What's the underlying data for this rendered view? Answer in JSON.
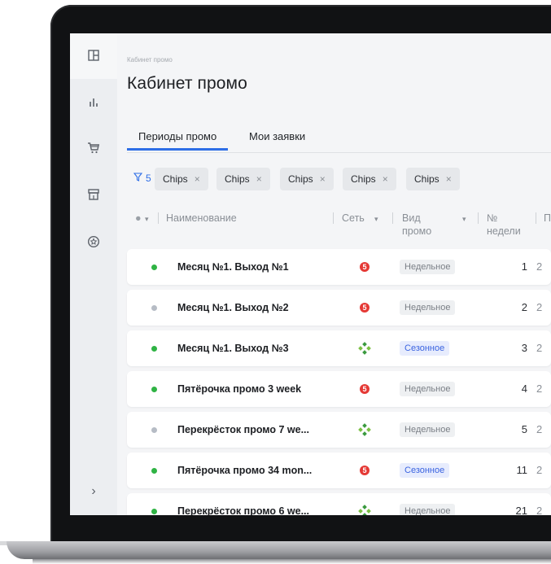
{
  "breadcrumb": "Кабинет промо",
  "page_title": "Кабинет промо",
  "tabs": [
    {
      "label": "Периоды промо",
      "active": true
    },
    {
      "label": "Мои заявки",
      "active": false
    }
  ],
  "filters": {
    "count": "5",
    "chips": [
      "Chips",
      "Chips",
      "Chips",
      "Chips",
      "Chips"
    ],
    "chip_close": "×"
  },
  "columns": {
    "status": "●",
    "name": "Наименование",
    "network": "Сеть",
    "type_line1": "Вид",
    "type_line2": "промо",
    "week_line1": "№",
    "week_line2": "недели",
    "next": "П"
  },
  "rows": [
    {
      "status": "active",
      "name": "Месяц №1. Выход №1",
      "network": "pyaterochka",
      "type": "Недельное",
      "type_kind": "weekly",
      "week": "1",
      "next": "2"
    },
    {
      "status": "inactive",
      "name": "Месяц №1. Выход №2",
      "network": "pyaterochka",
      "type": "Недельное",
      "type_kind": "weekly",
      "week": "2",
      "next": "2"
    },
    {
      "status": "active",
      "name": "Месяц №1. Выход №3",
      "network": "perekrestok",
      "type": "Сезонное",
      "type_kind": "season",
      "week": "3",
      "next": "2"
    },
    {
      "status": "active",
      "name": "Пятёрочка промо 3 week",
      "network": "pyaterochka",
      "type": "Недельное",
      "type_kind": "weekly",
      "week": "4",
      "next": "2"
    },
    {
      "status": "inactive",
      "name": "Перекрёсток промо 7 we...",
      "network": "perekrestok",
      "type": "Недельное",
      "type_kind": "weekly",
      "week": "5",
      "next": "2"
    },
    {
      "status": "active",
      "name": "Пятёрочка промо 34 mon...",
      "network": "pyaterochka",
      "type": "Сезонное",
      "type_kind": "season",
      "week": "11",
      "next": "2"
    },
    {
      "status": "active",
      "name": "Перекрёсток промо 6 we...",
      "network": "perekrestok",
      "type": "Недельное",
      "type_kind": "weekly",
      "week": "21",
      "next": "2"
    }
  ],
  "sidebar": {
    "items": [
      "layout-icon",
      "bar-chart-icon",
      "cart-icon",
      "store-icon",
      "badge-icon"
    ],
    "expand": "›"
  },
  "colors": {
    "accent": "#2e6ee6",
    "status_active": "#2fb344",
    "status_inactive": "#b6bcc5",
    "pyaterochka": "#e53935",
    "perekrestok": "#3a9a3e"
  }
}
